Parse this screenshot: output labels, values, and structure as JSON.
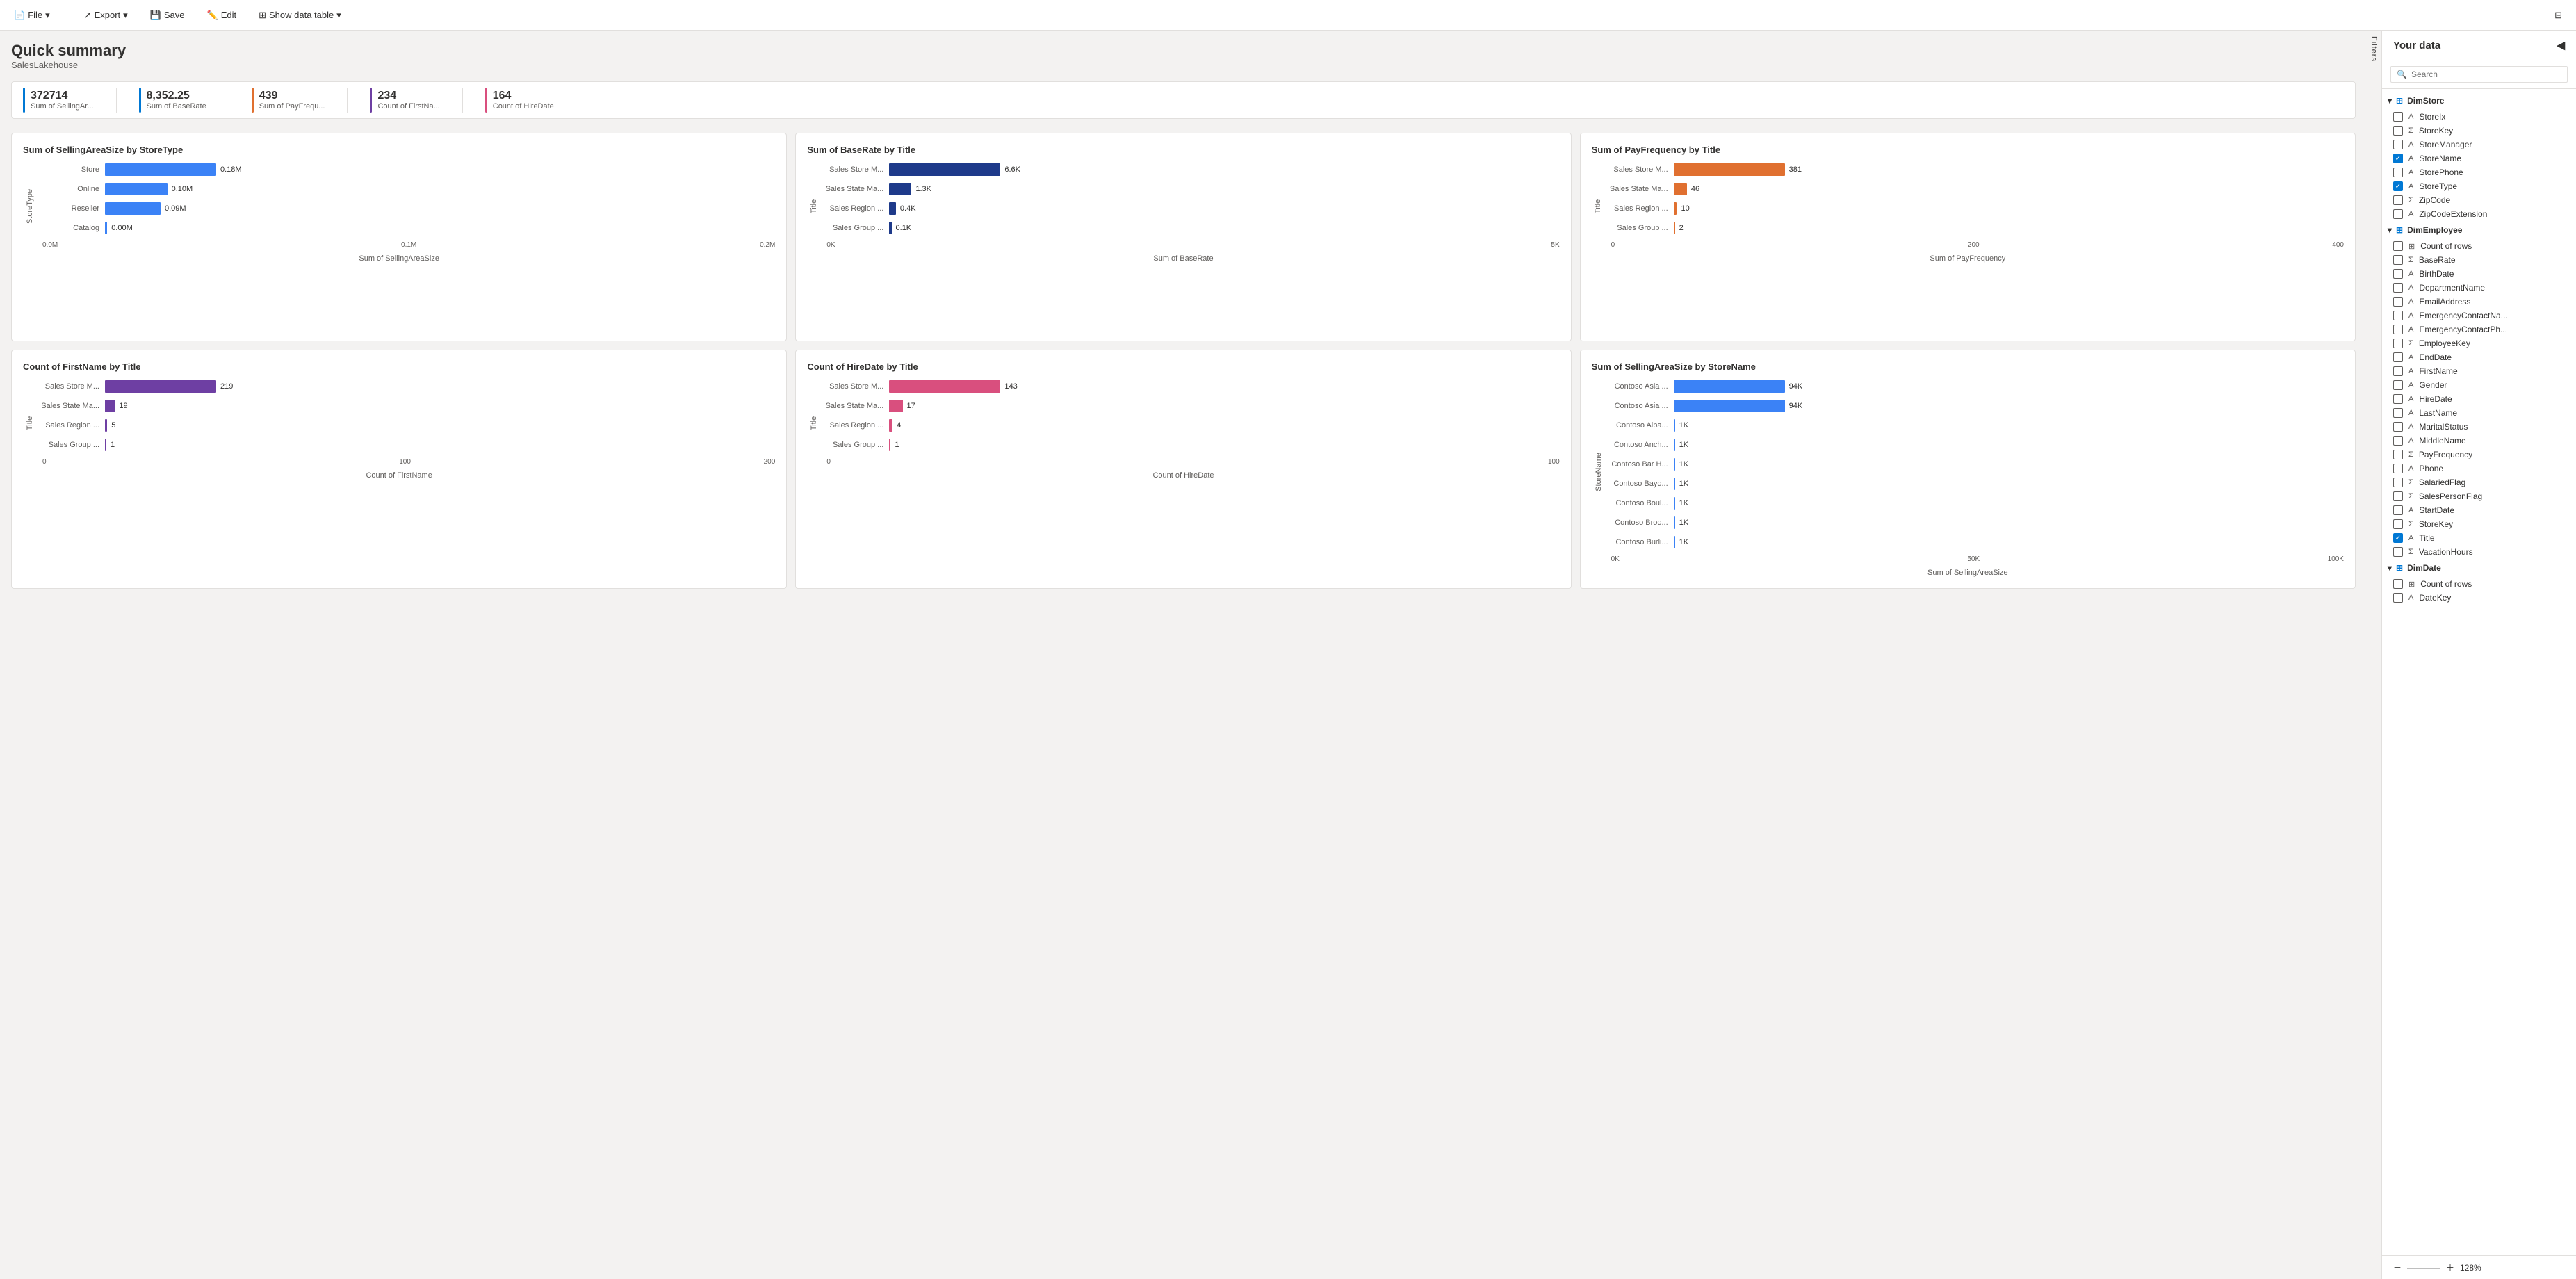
{
  "toolbar": {
    "file_label": "File",
    "export_label": "Export",
    "save_label": "Save",
    "edit_label": "Edit",
    "show_data_table_label": "Show data table",
    "window_icon": "⊟",
    "restore_icon": "❐"
  },
  "page": {
    "title": "Quick summary",
    "subtitle": "SalesLakehouse"
  },
  "kpis": [
    {
      "value": "372714",
      "label": "Sum of SellingAr...",
      "color": "#0078d4"
    },
    {
      "value": "8,352.25",
      "label": "Sum of BaseRate",
      "color": "#0078d4"
    },
    {
      "value": "439",
      "label": "Sum of PayFrequ...",
      "color": "#e07030"
    },
    {
      "value": "234",
      "label": "Count of FirstNa...",
      "color": "#6e3fa3"
    },
    {
      "value": "164",
      "label": "Count of HireDate",
      "color": "#d94f7e"
    }
  ],
  "charts": {
    "chart1": {
      "title": "Sum of SellingAreaSize by StoreType",
      "y_axis": "StoreType",
      "x_axis": "Sum of SellingAreaSize",
      "color": "#3b82f6",
      "bars": [
        {
          "label": "Store",
          "value": 0.18,
          "display": "0.18M",
          "pct": 100
        },
        {
          "label": "Online",
          "value": 0.1,
          "display": "0.10M",
          "pct": 56
        },
        {
          "label": "Reseller",
          "value": 0.09,
          "display": "0.09M",
          "pct": 50
        },
        {
          "label": "Catalog",
          "value": 0.0,
          "display": "0.00M",
          "pct": 2
        }
      ],
      "x_ticks": [
        "0.0M",
        "0.1M",
        "0.2M"
      ]
    },
    "chart2": {
      "title": "Sum of BaseRate by Title",
      "y_axis": "Title",
      "x_axis": "Sum of BaseRate",
      "color": "#1e3a8a",
      "bars": [
        {
          "label": "Sales Store M...",
          "value": 6.6,
          "display": "6.6K",
          "pct": 100
        },
        {
          "label": "Sales State Ma...",
          "value": 1.3,
          "display": "1.3K",
          "pct": 20
        },
        {
          "label": "Sales Region ...",
          "value": 0.4,
          "display": "0.4K",
          "pct": 6
        },
        {
          "label": "Sales Group ...",
          "value": 0.1,
          "display": "0.1K",
          "pct": 2
        }
      ],
      "x_ticks": [
        "0K",
        "5K"
      ]
    },
    "chart3": {
      "title": "Sum of PayFrequency by Title",
      "y_axis": "Title",
      "x_axis": "Sum of PayFrequency",
      "color": "#e07030",
      "bars": [
        {
          "label": "Sales Store M...",
          "value": 381,
          "display": "381",
          "pct": 100
        },
        {
          "label": "Sales State Ma...",
          "value": 46,
          "display": "46",
          "pct": 12
        },
        {
          "label": "Sales Region ...",
          "value": 10,
          "display": "10",
          "pct": 3
        },
        {
          "label": "Sales Group ...",
          "value": 2,
          "display": "2",
          "pct": 1
        }
      ],
      "x_ticks": [
        "0",
        "200",
        "400"
      ]
    },
    "chart4": {
      "title": "Count of FirstName by Title",
      "y_axis": "Title",
      "x_axis": "Count of FirstName",
      "color": "#6e3fa3",
      "bars": [
        {
          "label": "Sales Store M...",
          "value": 219,
          "display": "219",
          "pct": 100
        },
        {
          "label": "Sales State Ma...",
          "value": 19,
          "display": "19",
          "pct": 9
        },
        {
          "label": "Sales Region ...",
          "value": 5,
          "display": "5",
          "pct": 2
        },
        {
          "label": "Sales Group ...",
          "value": 1,
          "display": "1",
          "pct": 0.5
        }
      ],
      "x_ticks": [
        "0",
        "100",
        "200"
      ]
    },
    "chart5": {
      "title": "Count of HireDate by Title",
      "y_axis": "Title",
      "x_axis": "Count of HireDate",
      "color": "#d94f7e",
      "bars": [
        {
          "label": "Sales Store M...",
          "value": 143,
          "display": "143",
          "pct": 100
        },
        {
          "label": "Sales State Ma...",
          "value": 17,
          "display": "17",
          "pct": 12
        },
        {
          "label": "Sales Region ...",
          "value": 4,
          "display": "4",
          "pct": 3
        },
        {
          "label": "Sales Group ...",
          "value": 1,
          "display": "1",
          "pct": 1
        }
      ],
      "x_ticks": [
        "0",
        "100"
      ]
    },
    "chart6": {
      "title": "Sum of SellingAreaSize by StoreName",
      "y_axis": "StoreName",
      "x_axis": "Sum of SellingAreaSize",
      "color": "#3b82f6",
      "bars": [
        {
          "label": "Contoso Asia ...",
          "value": 94,
          "display": "94K",
          "pct": 100
        },
        {
          "label": "Contoso Asia ...",
          "value": 94,
          "display": "94K",
          "pct": 100
        },
        {
          "label": "Contoso Alba...",
          "value": 1,
          "display": "1K",
          "pct": 1
        },
        {
          "label": "Contoso Anch...",
          "value": 1,
          "display": "1K",
          "pct": 1
        },
        {
          "label": "Contoso Bar H...",
          "value": 1,
          "display": "1K",
          "pct": 1
        },
        {
          "label": "Contoso Bayo...",
          "value": 1,
          "display": "1K",
          "pct": 1
        },
        {
          "label": "Contoso Boul...",
          "value": 1,
          "display": "1K",
          "pct": 1
        },
        {
          "label": "Contoso Broo...",
          "value": 1,
          "display": "1K",
          "pct": 1
        },
        {
          "label": "Contoso Burli...",
          "value": 1,
          "display": "1K",
          "pct": 1
        }
      ],
      "x_ticks": [
        "0K",
        "50K",
        "100K"
      ]
    }
  },
  "sidebar": {
    "title": "Your data",
    "search_placeholder": "Search",
    "filters_label": "Filters",
    "sections": [
      {
        "name": "DimStore",
        "type": "table",
        "expanded": true,
        "items": [
          {
            "label": "StoreIx",
            "type": "text",
            "checked": false
          },
          {
            "label": "StoreKey",
            "type": "sigma",
            "checked": false
          },
          {
            "label": "StoreManager",
            "type": "text",
            "checked": false
          },
          {
            "label": "StoreName",
            "type": "text",
            "checked": true
          },
          {
            "label": "StorePhone",
            "type": "text",
            "checked": false
          },
          {
            "label": "StoreType",
            "type": "text",
            "checked": true
          },
          {
            "label": "ZipCode",
            "type": "sigma",
            "checked": false
          },
          {
            "label": "ZipCodeExtension",
            "type": "text",
            "checked": false
          }
        ]
      },
      {
        "name": "DimEmployee",
        "type": "table",
        "expanded": true,
        "items": [
          {
            "label": "Count of rows",
            "type": "count",
            "checked": false
          },
          {
            "label": "BaseRate",
            "type": "sigma",
            "checked": false
          },
          {
            "label": "BirthDate",
            "type": "text",
            "checked": false
          },
          {
            "label": "DepartmentName",
            "type": "text",
            "checked": false
          },
          {
            "label": "EmailAddress",
            "type": "text",
            "checked": false
          },
          {
            "label": "EmergencyContactNa...",
            "type": "text",
            "checked": false
          },
          {
            "label": "EmergencyContactPh...",
            "type": "text",
            "checked": false
          },
          {
            "label": "EmployeeKey",
            "type": "sigma",
            "checked": false
          },
          {
            "label": "EndDate",
            "type": "text",
            "checked": false
          },
          {
            "label": "FirstName",
            "type": "text",
            "checked": false
          },
          {
            "label": "Gender",
            "type": "text",
            "checked": false
          },
          {
            "label": "HireDate",
            "type": "text",
            "checked": false
          },
          {
            "label": "LastName",
            "type": "text",
            "checked": false
          },
          {
            "label": "MaritalStatus",
            "type": "text",
            "checked": false
          },
          {
            "label": "MiddleName",
            "type": "text",
            "checked": false
          },
          {
            "label": "PayFrequency",
            "type": "sigma",
            "checked": false
          },
          {
            "label": "Phone",
            "type": "text",
            "checked": false
          },
          {
            "label": "SalariedFlag",
            "type": "sigma",
            "checked": false
          },
          {
            "label": "SalesPersonFlag",
            "type": "sigma",
            "checked": false
          },
          {
            "label": "StartDate",
            "type": "text",
            "checked": false
          },
          {
            "label": "StoreKey",
            "type": "sigma",
            "checked": false
          },
          {
            "label": "Title",
            "type": "text",
            "checked": true
          },
          {
            "label": "VacationHours",
            "type": "sigma",
            "checked": false
          }
        ]
      },
      {
        "name": "DimDate",
        "type": "table",
        "expanded": true,
        "items": [
          {
            "label": "Count of rows",
            "type": "count",
            "checked": false
          },
          {
            "label": "DateKey",
            "type": "text",
            "checked": false
          }
        ]
      }
    ],
    "zoom_label": "128%"
  }
}
